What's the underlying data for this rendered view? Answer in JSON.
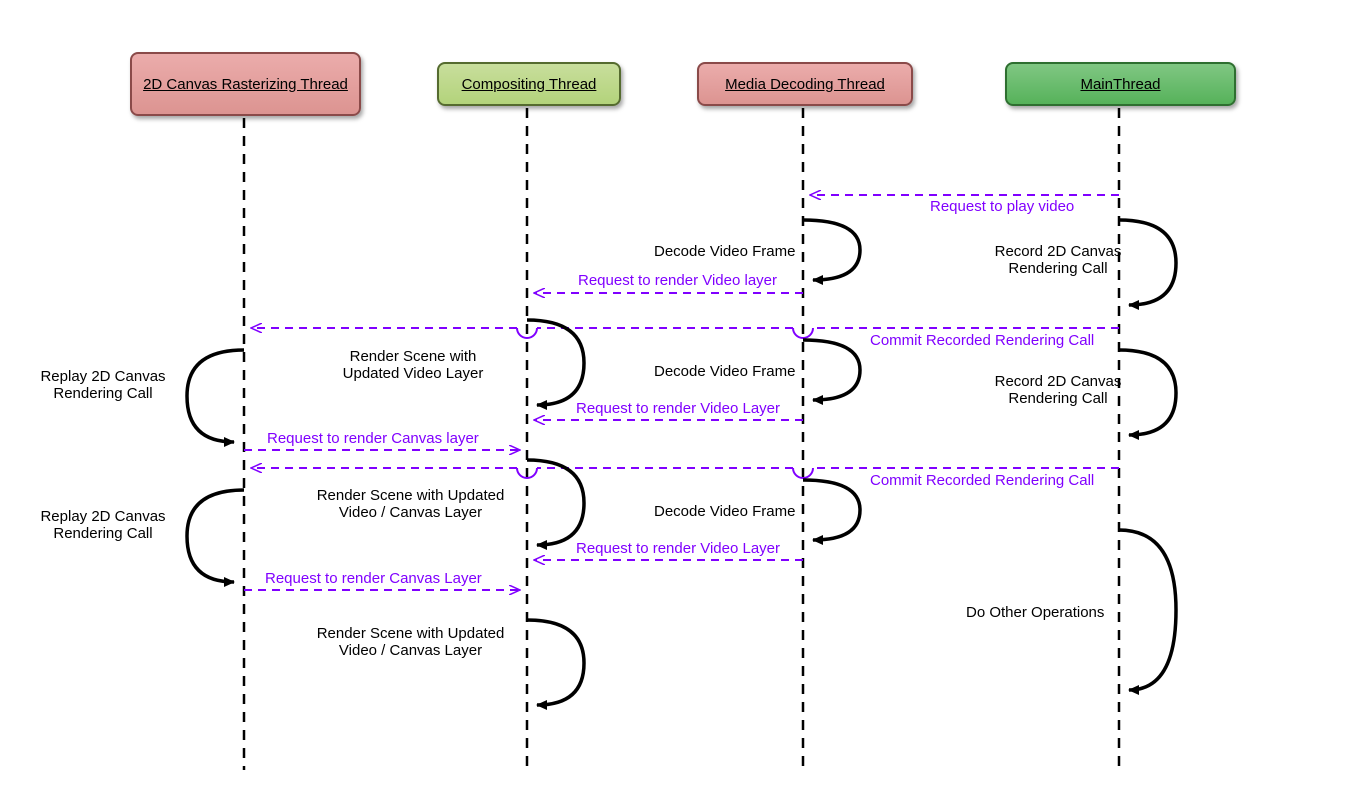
{
  "participants": {
    "p1": "2D Canvas Rasterizing Thread",
    "p2": "Compositing Thread",
    "p3": "Media Decoding Thread",
    "p4": "MainThread"
  },
  "messages": {
    "m1": "Request to play video",
    "m2": "Decode Video Frame",
    "m3": "Record 2D Canvas Rendering Call",
    "m4": "Request to render Video layer",
    "m5": "Commit Recorded Rendering Call",
    "m6": "Render Scene with Updated Video Layer",
    "m7": "Decode Video Frame",
    "m8": "Replay 2D Canvas Rendering Call",
    "m9": "Record 2D Canvas Rendering Call",
    "m10": "Request to render Video Layer",
    "m11": "Request to render Canvas layer",
    "m12": "Commit Recorded Rendering Call",
    "m13": "Render Scene with Updated Video / Canvas Layer",
    "m14": "Decode Video Frame",
    "m15": "Replay 2D Canvas Rendering Call",
    "m16": "Request to render Video Layer",
    "m17": "Request to render Canvas Layer",
    "m18": "Do Other Operations",
    "m19": "Render Scene with Updated Video / Canvas Layer"
  },
  "chart_data": {
    "type": "sequence-diagram",
    "participants": [
      {
        "id": "p1",
        "name": "2D Canvas Rasterizing Thread",
        "color": "pink"
      },
      {
        "id": "p2",
        "name": "Compositing Thread",
        "color": "lightgreen"
      },
      {
        "id": "p3",
        "name": "Media Decoding Thread",
        "color": "pink"
      },
      {
        "id": "p4",
        "name": "MainThread",
        "color": "green"
      }
    ],
    "interactions": [
      {
        "from": "p4",
        "to": "p3",
        "label": "Request to play video",
        "style": "dashed-async"
      },
      {
        "from": "p3",
        "to": "p3",
        "label": "Decode Video Frame",
        "style": "self"
      },
      {
        "from": "p4",
        "to": "p4",
        "label": "Record 2D Canvas Rendering Call",
        "style": "self"
      },
      {
        "from": "p3",
        "to": "p2",
        "label": "Request to render Video layer",
        "style": "dashed-async"
      },
      {
        "from": "p4",
        "to": "p1",
        "label": "Commit Recorded Rendering Call",
        "style": "dashed-async"
      },
      {
        "from": "p2",
        "to": "p2",
        "label": "Render Scene with Updated Video Layer",
        "style": "self"
      },
      {
        "from": "p3",
        "to": "p3",
        "label": "Decode Video Frame",
        "style": "self"
      },
      {
        "from": "p1",
        "to": "p1",
        "label": "Replay 2D Canvas Rendering Call",
        "style": "self"
      },
      {
        "from": "p4",
        "to": "p4",
        "label": "Record 2D Canvas Rendering Call",
        "style": "self"
      },
      {
        "from": "p3",
        "to": "p2",
        "label": "Request to render Video Layer",
        "style": "dashed-async"
      },
      {
        "from": "p1",
        "to": "p2",
        "label": "Request to render Canvas layer",
        "style": "dashed-async"
      },
      {
        "from": "p4",
        "to": "p1",
        "label": "Commit Recorded Rendering Call",
        "style": "dashed-async"
      },
      {
        "from": "p2",
        "to": "p2",
        "label": "Render Scene with Updated Video / Canvas Layer",
        "style": "self"
      },
      {
        "from": "p3",
        "to": "p3",
        "label": "Decode Video Frame",
        "style": "self"
      },
      {
        "from": "p1",
        "to": "p1",
        "label": "Replay 2D Canvas Rendering Call",
        "style": "self"
      },
      {
        "from": "p3",
        "to": "p2",
        "label": "Request to render Video Layer",
        "style": "dashed-async"
      },
      {
        "from": "p1",
        "to": "p2",
        "label": "Request to render Canvas Layer",
        "style": "dashed-async"
      },
      {
        "from": "p4",
        "to": "p4",
        "label": "Do Other Operations",
        "style": "self"
      },
      {
        "from": "p2",
        "to": "p2",
        "label": "Render Scene with Updated Video / Canvas Layer",
        "style": "self"
      }
    ]
  }
}
